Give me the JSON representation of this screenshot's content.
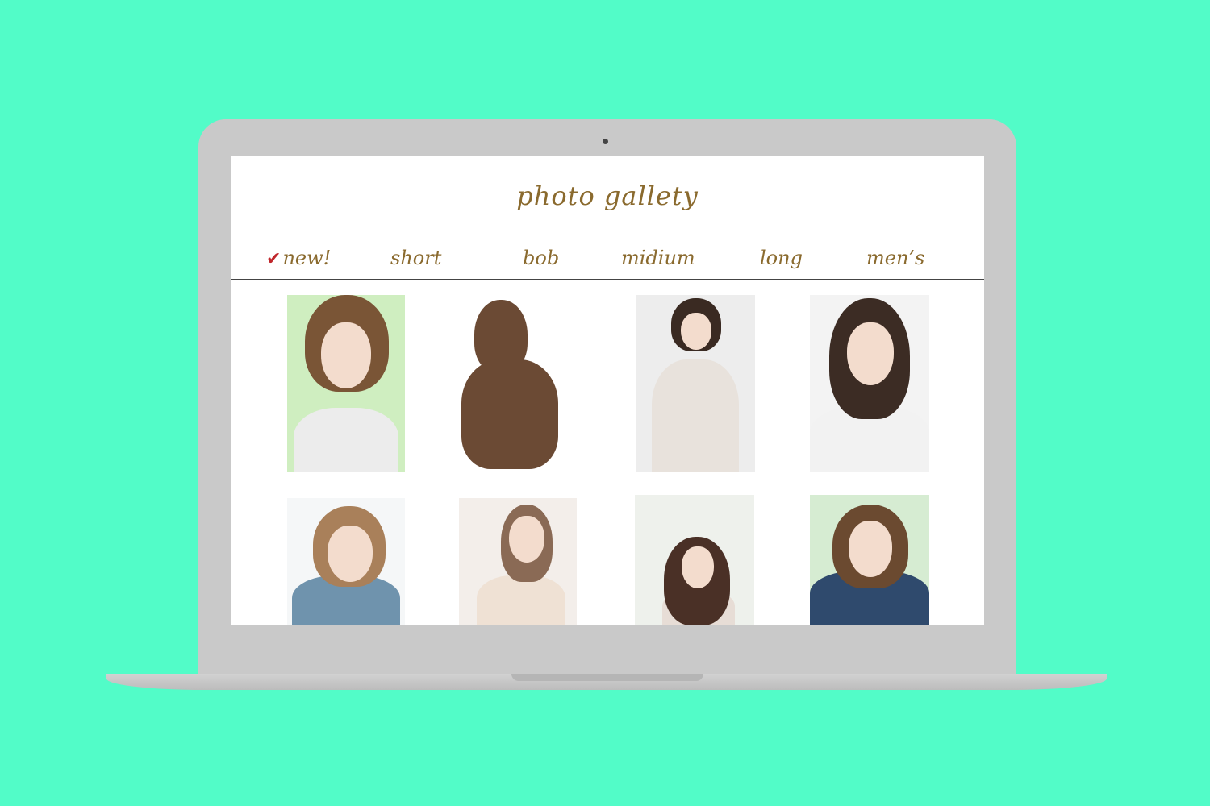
{
  "colors": {
    "page_background": "#52fcc8",
    "laptop": "#c9c9c9",
    "screen": "#ffffff",
    "text_gold": "#8a6a2e",
    "check_red": "#c0262b"
  },
  "site": {
    "title": "photo gallety"
  },
  "nav": {
    "items": [
      {
        "label": "new!",
        "active": true,
        "icon": "check-icon"
      },
      {
        "label": "short"
      },
      {
        "label": "bob"
      },
      {
        "label": "midium"
      },
      {
        "label": "long"
      },
      {
        "label": "men’s"
      }
    ]
  },
  "gallery": {
    "photos": [
      {
        "subject": "short-bob-portrait",
        "bg": "#cfeec0",
        "hair": "#7a5536",
        "top": "#ececec"
      },
      {
        "subject": "braided-ponytail-back-view",
        "bg": "#ffffff",
        "hair": "#6b4a34",
        "top": "#ffffff"
      },
      {
        "subject": "seated-woman-medium-hair",
        "bg": "#ededed",
        "hair": "#3a2a22",
        "top": "#e8e2dc"
      },
      {
        "subject": "medium-length-portrait",
        "bg": "#f3f3f3",
        "hair": "#3c2c24",
        "top": "#f2f2f2"
      },
      {
        "subject": "light-bob-portrait",
        "bg": "#f5f7f8",
        "hair": "#a9805a",
        "top": "#6f93ad"
      },
      {
        "subject": "soft-light-portrait",
        "bg": "#f3eeea",
        "hair": "#8a6a55",
        "top": "#efe1d4"
      },
      {
        "subject": "long-wavy-hair-portrait",
        "bg": "#eef1ec",
        "hair": "#4a3026",
        "top": "#e7ddd6"
      },
      {
        "subject": "denim-jacket-bob-portrait",
        "bg": "#d6ecd2",
        "hair": "#6b4a30",
        "top": "#2f4a6d"
      }
    ]
  }
}
